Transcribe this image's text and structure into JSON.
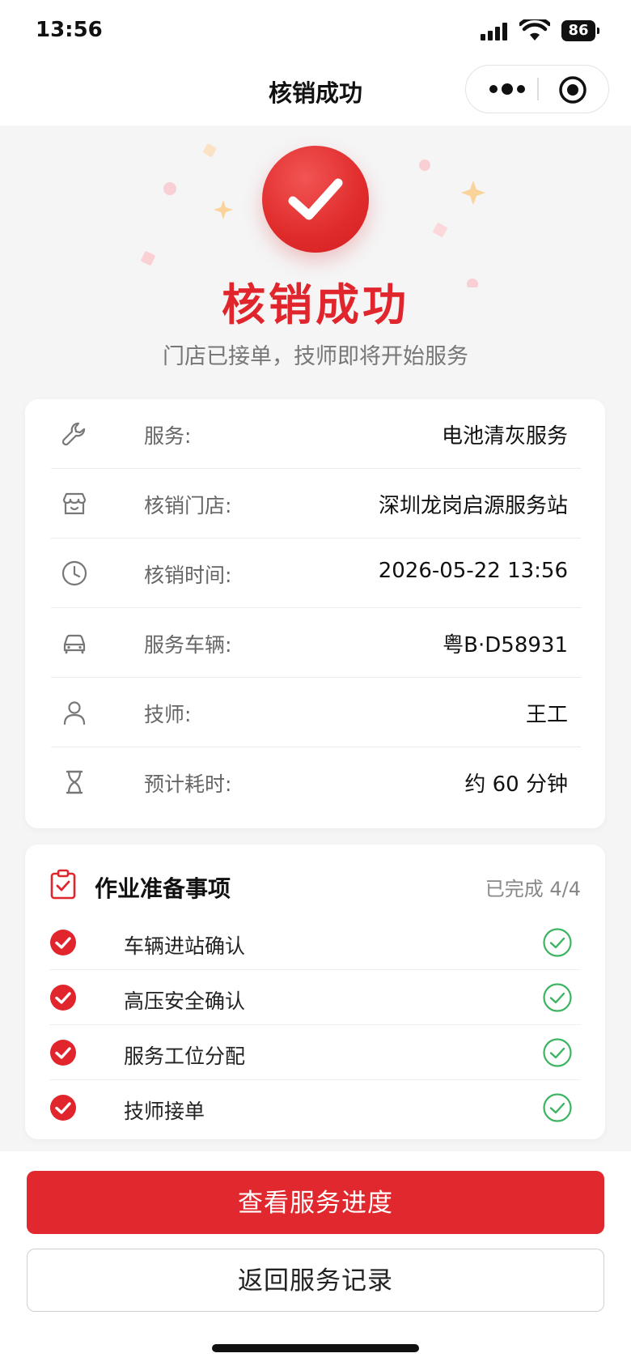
{
  "status_bar": {
    "time": "13:56",
    "battery": "86"
  },
  "nav": {
    "title": "核销成功"
  },
  "hero": {
    "title": "核销成功",
    "subtitle": "门店已接单，技师即将开始服务",
    "accent_color": "#e0262c"
  },
  "info": [
    {
      "icon": "wrench-icon",
      "label": "服务:",
      "value": "电池清灰服务"
    },
    {
      "icon": "store-icon",
      "label": "核销门店:",
      "value": "深圳龙岗启源服务站"
    },
    {
      "icon": "clock-icon",
      "label": "核销时间:",
      "value": "2026-05-22 13:56"
    },
    {
      "icon": "car-icon",
      "label": "服务车辆:",
      "value": "粤B·D58931"
    },
    {
      "icon": "person-icon",
      "label": "技师:",
      "value": "王工"
    },
    {
      "icon": "hourglass-icon",
      "label": "预计耗时:",
      "value": "约 60 分钟"
    }
  ],
  "prep": {
    "title": "作业准备事项",
    "progress": "已完成 4/4",
    "items": [
      {
        "label": "车辆进站确认",
        "done": true
      },
      {
        "label": "高压安全确认",
        "done": true
      },
      {
        "label": "服务工位分配",
        "done": true
      },
      {
        "label": "技师接单",
        "done": true
      }
    ]
  },
  "actions": {
    "primary": "查看服务进度",
    "secondary": "返回服务记录"
  }
}
